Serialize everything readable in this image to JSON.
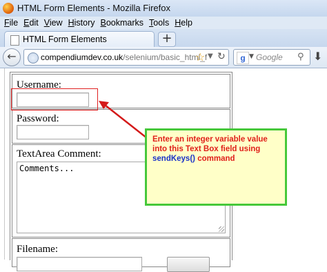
{
  "window": {
    "title": "HTML Form Elements - Mozilla Firefox"
  },
  "menu": [
    "File",
    "Edit",
    "View",
    "History",
    "Bookmarks",
    "Tools",
    "Help"
  ],
  "tab": {
    "title": "HTML Form Elements",
    "new_tab_label": "+"
  },
  "nav": {
    "url_host": "compendiumdev.co.uk",
    "url_path": "/selenium/basic_html_f",
    "search_placeholder": "Google"
  },
  "form": {
    "username_label": "Username:",
    "password_label": "Password:",
    "textarea_label": "TextArea Comment:",
    "textarea_value": "Comments...",
    "filename_label": "Filename:"
  },
  "annotation": {
    "line1": "Enter an integer variable value",
    "line2": "into this Text Box field using",
    "command": "sendKeys()",
    "command_suffix": " command"
  },
  "colors": {
    "highlight": "#e02020",
    "callout_border": "#46c83a",
    "callout_bg": "#ffffc8"
  }
}
